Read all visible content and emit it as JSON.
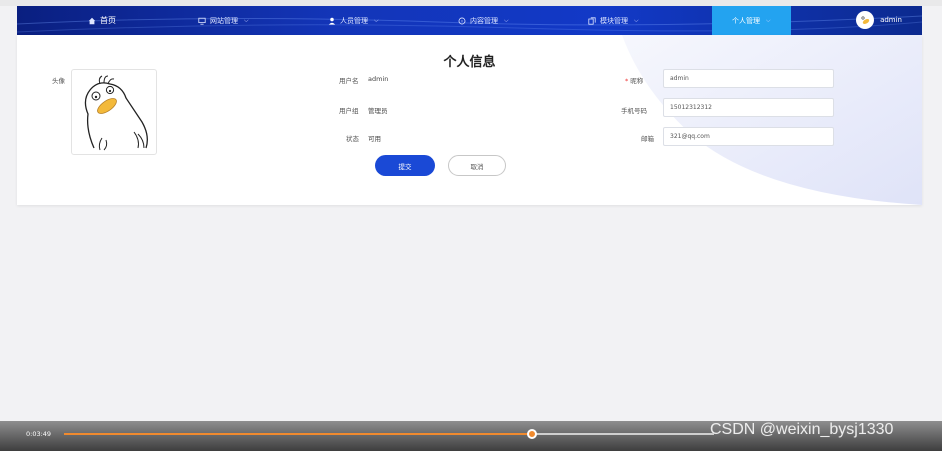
{
  "nav": {
    "items": [
      {
        "label": "首页",
        "icon": "home-icon"
      },
      {
        "label": "网站管理",
        "icon": "monitor-icon"
      },
      {
        "label": "人员管理",
        "icon": "user-icon"
      },
      {
        "label": "内容管理",
        "icon": "chat-icon"
      },
      {
        "label": "模块管理",
        "icon": "copy-icon"
      },
      {
        "label": "个人管理",
        "icon": ""
      }
    ],
    "user": "admin"
  },
  "profile": {
    "title": "个人信息",
    "avatar_label": "头像",
    "username_label": "用户名",
    "username_value": "admin",
    "group_label": "用户组",
    "group_value": "管理员",
    "status_label": "状态",
    "status_value": "可用",
    "nickname_label": "昵称",
    "nickname_required": "*",
    "nickname_value": "admin",
    "phone_label": "手机号码",
    "phone_value": "15012312312",
    "email_label": "邮箱",
    "email_value": "321@qq.com",
    "submit": "提交",
    "cancel": "取消"
  },
  "player": {
    "time": "0:03:49",
    "progress": 0.72,
    "watermark": "CSDN @weixin_bysj1330"
  },
  "colors": {
    "nav_dark": "#0a1f80",
    "nav_active": "#23a3f0",
    "primary_button": "#1a49d6",
    "progress": "#f08a2e"
  }
}
